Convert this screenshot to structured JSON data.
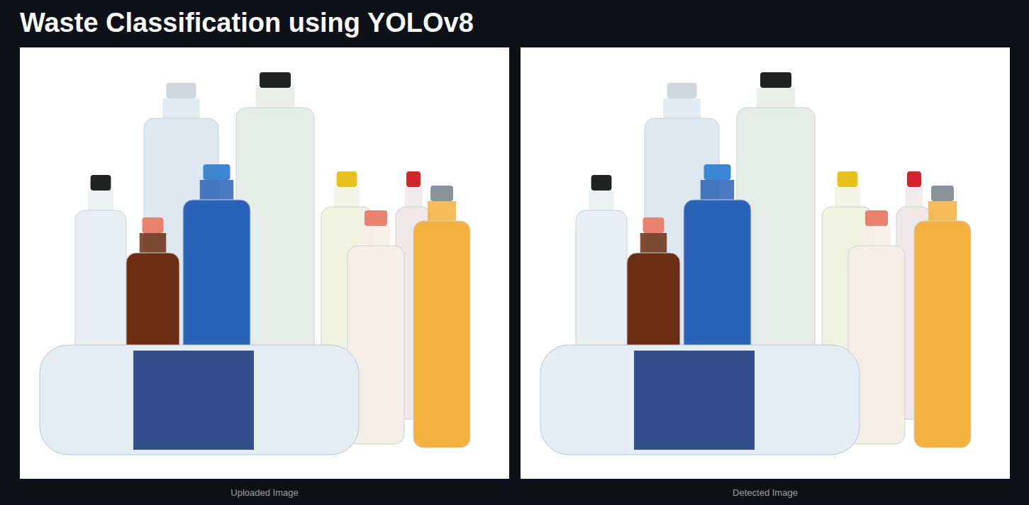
{
  "title": "Waste Classification using YOLOv8",
  "images": [
    {
      "caption": "Uploaded Image"
    },
    {
      "caption": "Detected Image"
    }
  ]
}
